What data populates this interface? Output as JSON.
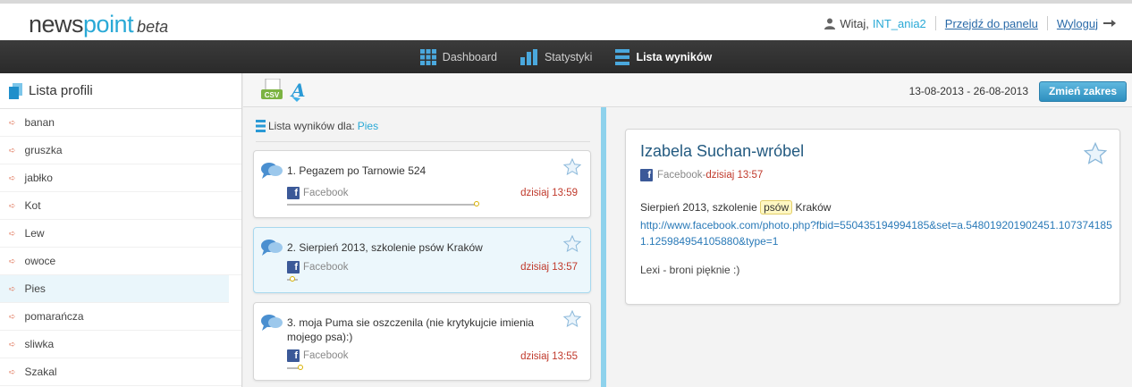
{
  "header": {
    "logo_main_a": "news",
    "logo_main_b": "point",
    "logo_beta": "beta",
    "greeting": "Witaj,",
    "username": "INT_ania2",
    "panel_link": "Przejdź do panelu",
    "logout_link": "Wyloguj"
  },
  "nav": {
    "items": [
      {
        "label": "Dashboard",
        "icon": "grid-icon"
      },
      {
        "label": "Statystyki",
        "icon": "bar-chart-icon"
      },
      {
        "label": "Lista wyników",
        "icon": "list-icon",
        "active": true
      }
    ]
  },
  "sidebar": {
    "title": "Lista profili",
    "items": [
      "banan",
      "gruszka",
      "jabłko",
      "Kot",
      "Lew",
      "owoce",
      "Pies",
      "pomarańcza",
      "sliwka",
      "Szakal"
    ],
    "active_item": "Pies"
  },
  "toolbar": {
    "csv_label": "CSV",
    "date_range": "13-08-2013 - 26-08-2013",
    "change_range_button": "Zmień zakres"
  },
  "results": {
    "heading": "Lista wyników dla:",
    "query": "Pies",
    "items": [
      {
        "title": "1. Pegazem po Tarnowie 524",
        "source": "Facebook",
        "time": "dzisiaj 13:59",
        "progress": 1.0
      },
      {
        "title": "2. Sierpień 2013, szkolenie psów Kraków",
        "source": "Facebook",
        "time": "dzisiaj 13:57",
        "progress": 0.04,
        "selected": true
      },
      {
        "title": "3. moja Puma sie oszczenila (nie krytykujcie imienia mojego psa):)",
        "source": "Facebook",
        "time": "dzisiaj 13:55",
        "progress": 0.06
      }
    ]
  },
  "detail": {
    "author": "Izabela Suchan-wróbel",
    "source": "Facebook",
    "separator": " - ",
    "time": "dzisiaj 13:57",
    "text_before": "Sierpień 2013, szkolenie ",
    "highlight": "psów",
    "text_after": " Kraków",
    "link": "http://www.facebook.com/photo.php?fbid=550435194994185&set=a.548019201902451.1073741851.125984954105880&type=1",
    "body": "Lexi - broni pięknie :)"
  },
  "colors": {
    "accent": "#29a9d6",
    "link": "#2a6aa8",
    "time_red": "#c0392b",
    "navbar": "#2f2f2f",
    "divider": "#8ed2ec"
  }
}
